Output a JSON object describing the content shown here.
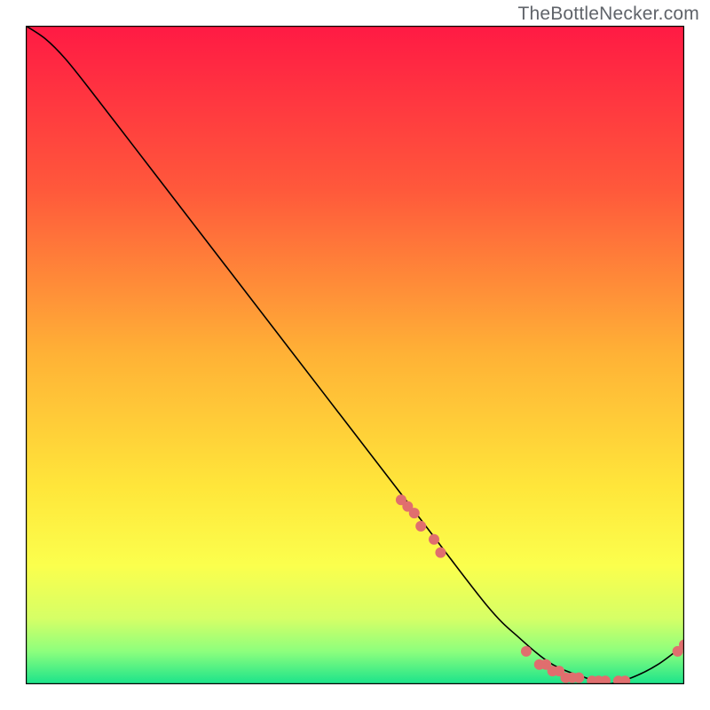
{
  "watermark": "TheBottleNecker.com",
  "chart_data": {
    "type": "line",
    "title": "",
    "xlabel": "",
    "ylabel": "",
    "xlim": [
      0,
      100
    ],
    "ylim": [
      0,
      100
    ],
    "background": {
      "type": "vertical-gradient",
      "stops": [
        {
          "offset": 0.0,
          "color": "#ff1a44"
        },
        {
          "offset": 0.25,
          "color": "#ff593b"
        },
        {
          "offset": 0.5,
          "color": "#ffb236"
        },
        {
          "offset": 0.7,
          "color": "#ffe63a"
        },
        {
          "offset": 0.82,
          "color": "#fbff4d"
        },
        {
          "offset": 0.9,
          "color": "#d6ff66"
        },
        {
          "offset": 0.95,
          "color": "#8dff7d"
        },
        {
          "offset": 1.0,
          "color": "#19e38b"
        }
      ]
    },
    "frame": true,
    "curve": {
      "description": "Bottleneck curve — high on the left, descends to a minimum near x≈87, then rises slightly.",
      "x": [
        0,
        3,
        6,
        10,
        20,
        30,
        40,
        50,
        60,
        70,
        75,
        80,
        85,
        88,
        92,
        96,
        100
      ],
      "y": [
        100,
        98,
        95,
        90,
        77,
        64,
        51,
        38,
        25,
        12,
        7,
        3,
        1,
        0,
        1,
        3,
        6
      ]
    },
    "markers": {
      "color": "#e06e6e",
      "radius_px": 6,
      "points_x": [
        57,
        58,
        59,
        60,
        62,
        63,
        76,
        78,
        79,
        80,
        81,
        82,
        83,
        84,
        86,
        87,
        88,
        90,
        91,
        99,
        100
      ],
      "points_y": [
        28,
        27,
        26,
        24,
        22,
        20,
        5,
        3,
        3,
        2,
        2,
        1,
        1,
        1,
        0.5,
        0.5,
        0.5,
        0.5,
        0.5,
        5,
        6
      ]
    }
  }
}
